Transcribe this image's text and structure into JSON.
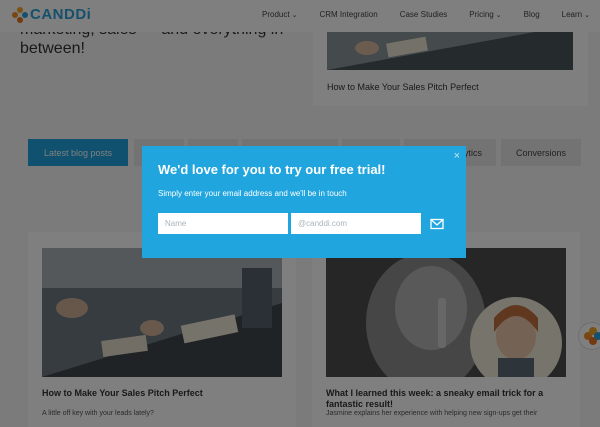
{
  "nav": {
    "logo_text": "CANDDi",
    "items": [
      {
        "label": "Product",
        "has_dropdown": true
      },
      {
        "label": "CRM Integration",
        "has_dropdown": false
      },
      {
        "label": "Case Studies",
        "has_dropdown": false
      },
      {
        "label": "Pricing",
        "has_dropdown": true
      },
      {
        "label": "Blog",
        "has_dropdown": false
      },
      {
        "label": "Learn",
        "has_dropdown": true
      }
    ]
  },
  "hero": {
    "text": "marketing, sales — and everything in between!"
  },
  "featured": {
    "title": "How to Make Your Sales Pitch Perfect"
  },
  "tabs": [
    {
      "label": "Latest blog posts",
      "active": true
    },
    {
      "label": "",
      "active": false
    },
    {
      "label": "",
      "active": false
    },
    {
      "label": "",
      "active": false
    },
    {
      "label": "",
      "active": false
    },
    {
      "label": "ytics",
      "active": false
    },
    {
      "label": "Conversions",
      "active": false
    }
  ],
  "cards": [
    {
      "title": "How to Make Your Sales Pitch Perfect",
      "excerpt": "A little off key with your leads lately?"
    },
    {
      "title": "What I learned this week: a sneaky email trick for a fantastic result!",
      "excerpt": "Jasmine explains her experience with helping new sign-ups get their"
    }
  ],
  "modal": {
    "title": "We'd love for you to try our free trial!",
    "subtitle": "Simply enter your email address and we'll be in touch",
    "name_placeholder": "Name",
    "email_placeholder": "@canddi.com",
    "close_glyph": "×"
  },
  "colors": {
    "brand_blue": "#20a5de",
    "logo_orange": "#f28c28",
    "overlay": "rgba(0,0,0,0.5)"
  }
}
